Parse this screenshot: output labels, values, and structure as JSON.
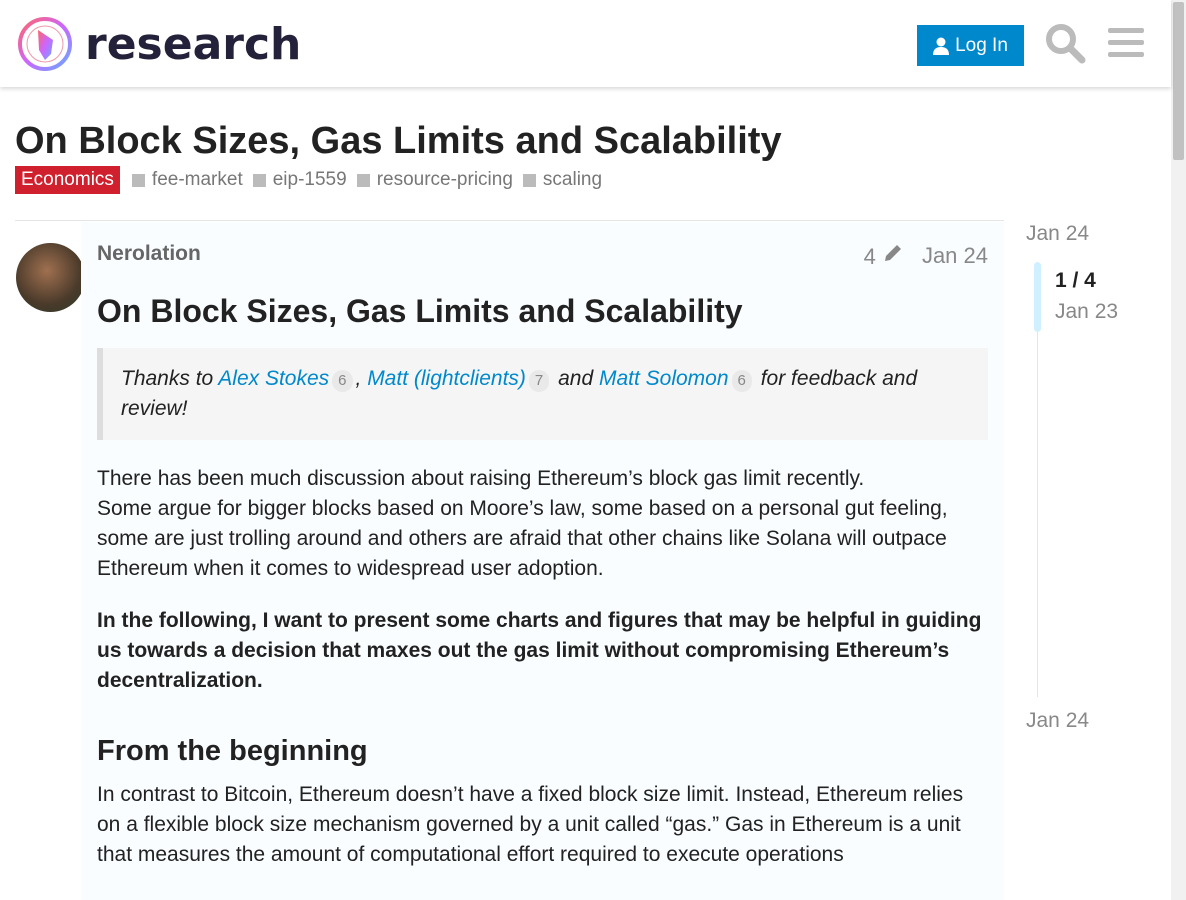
{
  "header": {
    "site_name": "research",
    "login_label": "Log In"
  },
  "topic": {
    "title": "On Block Sizes, Gas Limits and Scalability",
    "category": "Economics",
    "tags": [
      "fee-market",
      "eip-1559",
      "resource-pricing",
      "scaling"
    ]
  },
  "post": {
    "author": "Nerolation",
    "edit_count": "4",
    "date": "Jan 24",
    "heading": "On Block Sizes, Gas Limits and Scalability",
    "quote": {
      "prefix": "Thanks to ",
      "people": [
        {
          "name": "Alex Stokes",
          "count": "6"
        },
        {
          "name": "Matt (lightclients)",
          "count": "7"
        },
        {
          "name": "Matt Solomon",
          "count": "6"
        }
      ],
      "sep1": ", ",
      "sep2": " and ",
      "suffix": " for feedback and review!"
    },
    "p1_line1": "There has been much discussion about raising Ethereum’s block gas limit recently.",
    "p1_line2": "Some argue for bigger blocks based on Moore’s law, some based on a personal gut feeling, some are just trolling around and others are afraid that other chains like Solana will outpace Ethereum when it comes to widespread user adoption.",
    "p2": "In the following, I want to present some charts and figures that may be helpful in guiding us towards a decision that maxes out the gas limit without compromising Ethereum’s decentralization.",
    "section_heading": "From the beginning",
    "p3": "In contrast to Bitcoin, Ethereum doesn’t have a fixed block size limit. Instead, Ethereum relies on a flexible block size mechanism governed by a unit called “gas.” Gas in Ethereum is a unit that measures the amount of computational effort required to execute operations"
  },
  "timeline": {
    "top_date": "Jan 24",
    "position": "1 / 4",
    "current_date": "Jan 23",
    "bottom_date": "Jan 24"
  }
}
